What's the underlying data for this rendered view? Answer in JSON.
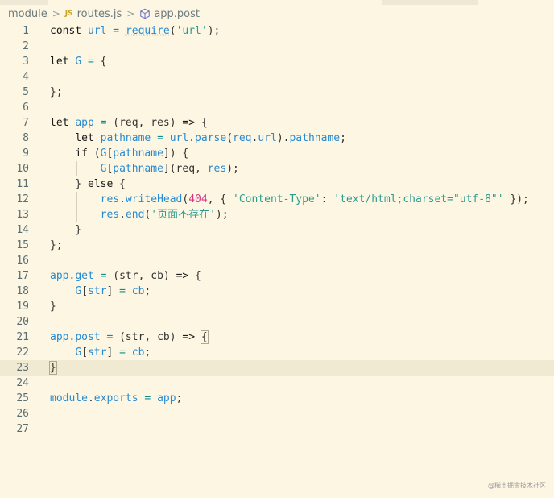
{
  "breadcrumb": {
    "folder": "module",
    "file_badge": "JS",
    "file": "routes.js",
    "symbol": "app.post"
  },
  "colors": {
    "background": "#fdf6e3",
    "variable": "#268bd2",
    "string": "#2a9d8f",
    "number": "#d33682",
    "current_line": "#f1ead3"
  },
  "editor": {
    "current_line": 23,
    "lines": [
      {
        "n": "1",
        "tokens": [
          [
            "kw",
            "const "
          ],
          [
            "var",
            "url"
          ],
          [
            "op",
            " = "
          ],
          [
            "var",
            "require"
          ],
          [
            "pun",
            "("
          ],
          [
            "str",
            "'url'"
          ],
          [
            "pun",
            ");"
          ]
        ]
      },
      {
        "n": "2",
        "tokens": []
      },
      {
        "n": "3",
        "tokens": [
          [
            "kw",
            "let "
          ],
          [
            "var",
            "G"
          ],
          [
            "op",
            " = "
          ],
          [
            "pun",
            "{"
          ]
        ]
      },
      {
        "n": "4",
        "tokens": []
      },
      {
        "n": "5",
        "tokens": [
          [
            "pun",
            "};"
          ]
        ]
      },
      {
        "n": "6",
        "tokens": []
      },
      {
        "n": "7",
        "tokens": [
          [
            "kw",
            "let "
          ],
          [
            "var",
            "app"
          ],
          [
            "op",
            " = "
          ],
          [
            "pun",
            "(req, res) "
          ],
          [
            "kw",
            "=> "
          ],
          [
            "pun",
            "{"
          ]
        ]
      },
      {
        "n": "8",
        "tokens": [
          [
            "pun",
            "    "
          ],
          [
            "kw",
            "let "
          ],
          [
            "var",
            "pathname"
          ],
          [
            "op",
            " = "
          ],
          [
            "var",
            "url"
          ],
          [
            "pun",
            "."
          ],
          [
            "var",
            "parse"
          ],
          [
            "pun",
            "("
          ],
          [
            "var",
            "req"
          ],
          [
            "pun",
            "."
          ],
          [
            "var",
            "url"
          ],
          [
            "pun",
            ")."
          ],
          [
            "var",
            "pathname"
          ],
          [
            "pun",
            ";"
          ]
        ]
      },
      {
        "n": "9",
        "tokens": [
          [
            "pun",
            "    "
          ],
          [
            "kw",
            "if "
          ],
          [
            "pun",
            "("
          ],
          [
            "var",
            "G"
          ],
          [
            "pun",
            "["
          ],
          [
            "var",
            "pathname"
          ],
          [
            "pun",
            "]) {"
          ]
        ]
      },
      {
        "n": "10",
        "tokens": [
          [
            "pun",
            "        "
          ],
          [
            "var",
            "G"
          ],
          [
            "pun",
            "["
          ],
          [
            "var",
            "pathname"
          ],
          [
            "pun",
            "](req, "
          ],
          [
            "var",
            "res"
          ],
          [
            "pun",
            ");"
          ]
        ]
      },
      {
        "n": "11",
        "tokens": [
          [
            "pun",
            "    "
          ],
          [
            "pun",
            "} "
          ],
          [
            "kw",
            "else "
          ],
          [
            "pun",
            "{"
          ]
        ]
      },
      {
        "n": "12",
        "tokens": [
          [
            "pun",
            "        "
          ],
          [
            "var",
            "res"
          ],
          [
            "pun",
            "."
          ],
          [
            "var",
            "writeHead"
          ],
          [
            "pun",
            "("
          ],
          [
            "num",
            "404"
          ],
          [
            "pun",
            ", { "
          ],
          [
            "str",
            "'Content-Type'"
          ],
          [
            "pun",
            ": "
          ],
          [
            "str",
            "'text/html;charset=\"utf-8\"'"
          ],
          [
            "pun",
            " });"
          ]
        ]
      },
      {
        "n": "13",
        "tokens": [
          [
            "pun",
            "        "
          ],
          [
            "var",
            "res"
          ],
          [
            "pun",
            "."
          ],
          [
            "var",
            "end"
          ],
          [
            "pun",
            "("
          ],
          [
            "str",
            "'页面不存在'"
          ],
          [
            "pun",
            ");"
          ]
        ]
      },
      {
        "n": "14",
        "tokens": [
          [
            "pun",
            "    "
          ],
          [
            "pun",
            "}"
          ]
        ]
      },
      {
        "n": "15",
        "tokens": [
          [
            "pun",
            "};"
          ]
        ]
      },
      {
        "n": "16",
        "tokens": []
      },
      {
        "n": "17",
        "tokens": [
          [
            "var",
            "app"
          ],
          [
            "pun",
            "."
          ],
          [
            "var",
            "get"
          ],
          [
            "op",
            " = "
          ],
          [
            "pun",
            "(str, cb) "
          ],
          [
            "kw",
            "=> "
          ],
          [
            "pun",
            "{"
          ]
        ]
      },
      {
        "n": "18",
        "tokens": [
          [
            "pun",
            "    "
          ],
          [
            "var",
            "G"
          ],
          [
            "pun",
            "["
          ],
          [
            "var",
            "str"
          ],
          [
            "pun",
            "]"
          ],
          [
            "op",
            " = "
          ],
          [
            "var",
            "cb"
          ],
          [
            "pun",
            ";"
          ]
        ]
      },
      {
        "n": "19",
        "tokens": [
          [
            "pun",
            "}"
          ]
        ]
      },
      {
        "n": "20",
        "tokens": []
      },
      {
        "n": "21",
        "tokens": [
          [
            "var",
            "app"
          ],
          [
            "pun",
            "."
          ],
          [
            "var",
            "post"
          ],
          [
            "op",
            " = "
          ],
          [
            "pun",
            "(str, cb) "
          ],
          [
            "kw",
            "=> "
          ],
          [
            "pun",
            "{"
          ]
        ]
      },
      {
        "n": "22",
        "tokens": [
          [
            "pun",
            "    "
          ],
          [
            "var",
            "G"
          ],
          [
            "pun",
            "["
          ],
          [
            "var",
            "str"
          ],
          [
            "pun",
            "]"
          ],
          [
            "op",
            " = "
          ],
          [
            "var",
            "cb"
          ],
          [
            "pun",
            ";"
          ]
        ]
      },
      {
        "n": "23",
        "tokens": [
          [
            "pun",
            "}"
          ]
        ]
      },
      {
        "n": "24",
        "tokens": []
      },
      {
        "n": "25",
        "tokens": [
          [
            "var",
            "module"
          ],
          [
            "pun",
            "."
          ],
          [
            "var",
            "exports"
          ],
          [
            "op",
            " = "
          ],
          [
            "var",
            "app"
          ],
          [
            "pun",
            ";"
          ]
        ]
      },
      {
        "n": "26",
        "tokens": []
      },
      {
        "n": "27",
        "tokens": []
      }
    ]
  },
  "watermark": "@稀土掘金技术社区"
}
